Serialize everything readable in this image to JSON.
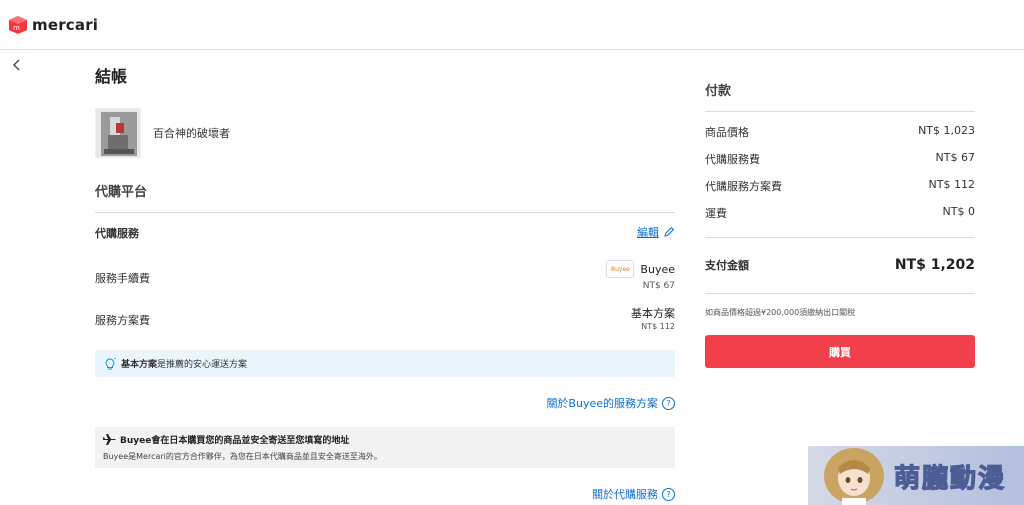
{
  "header": {
    "brand": "mercari"
  },
  "page": {
    "title": "結帳"
  },
  "product": {
    "name": "百合神的破壞者"
  },
  "proxy": {
    "section_title": "代購平台",
    "service_label": "代購服務",
    "edit_label": "編輯",
    "fee_label": "服務手續費",
    "provider_name": "Buyee",
    "provider_logo_text": "Buyee",
    "fee_value": "NT$ 67",
    "plan_fee_label": "服務方案費",
    "plan_name": "基本方案",
    "plan_value": "NT$ 112",
    "tip_bold": "基本方案",
    "tip_text": "是推薦的安心運送方案",
    "plan_link": "關於Buyee的服務方案",
    "notice_title": "Buyee會在日本購買您的商品並安全寄送至您填寫的地址",
    "notice_text": "Buyee是Mercari的官方合作夥伴，為您在日本代購商品並且安全寄送至海外。",
    "proxy_link": "關於代購服務"
  },
  "payment": {
    "title": "付款",
    "rows": [
      {
        "label": "商品價格",
        "value": "NT$ 1,023"
      },
      {
        "label": "代購服務費",
        "value": "NT$ 67"
      },
      {
        "label": "代購服務方案費",
        "value": "NT$ 112"
      },
      {
        "label": "運費",
        "value": "NT$ 0"
      }
    ],
    "total_label": "支付金額",
    "total_value": "NT$ 1,202",
    "note": "如商品價格超過¥200,000須繳納出口關稅",
    "buy_label": "購買"
  },
  "watermark": {
    "text": "萌朧動漫"
  },
  "icons": {
    "back": "chevron-left-icon",
    "edit": "pencil-icon",
    "tip": "lightbulb-icon",
    "help": "question-circle-icon",
    "plane": "airplane-icon"
  },
  "colors": {
    "accent": "#f1404b",
    "link": "#0a6fd4",
    "tip_bg": "#eaf6fc"
  }
}
